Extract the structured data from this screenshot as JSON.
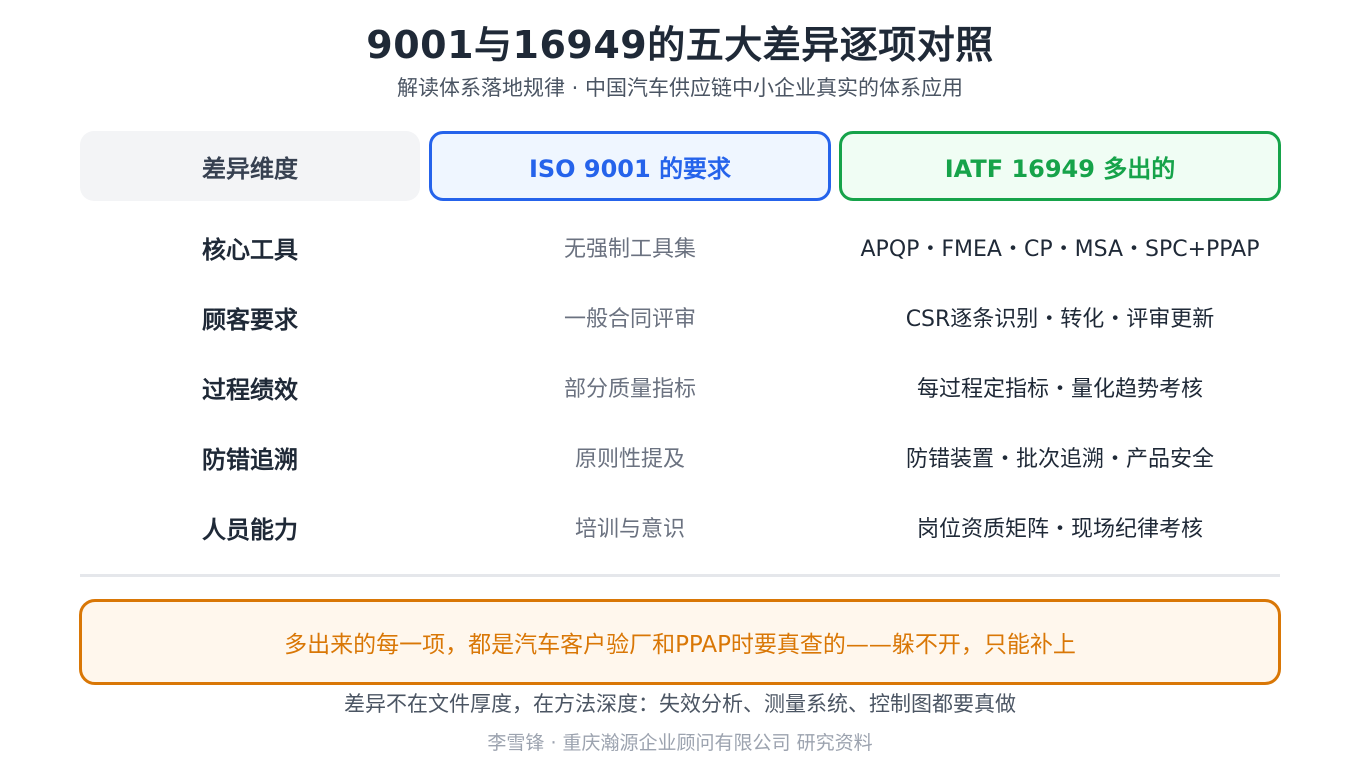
{
  "title": "9001与16949的五大差异逐项对照",
  "subtitle": "解读体系落地规律 · 中国汽车供应链中小企业真实的体系应用",
  "colors": {
    "iso_accent": "#2563eb",
    "iatf_accent": "#16a34a",
    "callout_accent": "#d97706"
  },
  "table": {
    "headers": {
      "dimension": "差异维度",
      "iso": "ISO 9001 的要求",
      "iatf": "IATF 16949 多出的"
    },
    "rows": [
      {
        "dimension": "核心工具",
        "iso": "无强制工具集",
        "iatf": "APQP・FMEA・CP・MSA・SPC+PPAP"
      },
      {
        "dimension": "顾客要求",
        "iso": "一般合同评审",
        "iatf": "CSR逐条识别・转化・评审更新"
      },
      {
        "dimension": "过程绩效",
        "iso": "部分质量指标",
        "iatf": "每过程定指标・量化趋势考核"
      },
      {
        "dimension": "防错追溯",
        "iso": "原则性提及",
        "iatf": "防错装置・批次追溯・产品安全"
      },
      {
        "dimension": "人员能力",
        "iso": "培训与意识",
        "iatf": "岗位资质矩阵・现场纪律考核"
      }
    ]
  },
  "callout": "多出来的每一项，都是汽车客户验厂和PPAP时要真查的——躲不开，只能补上",
  "note": "差异不在文件厚度，在方法深度：失效分析、测量系统、控制图都要真做",
  "footer": "李雪锋 · 重庆瀚源企业顾问有限公司 研究资料"
}
